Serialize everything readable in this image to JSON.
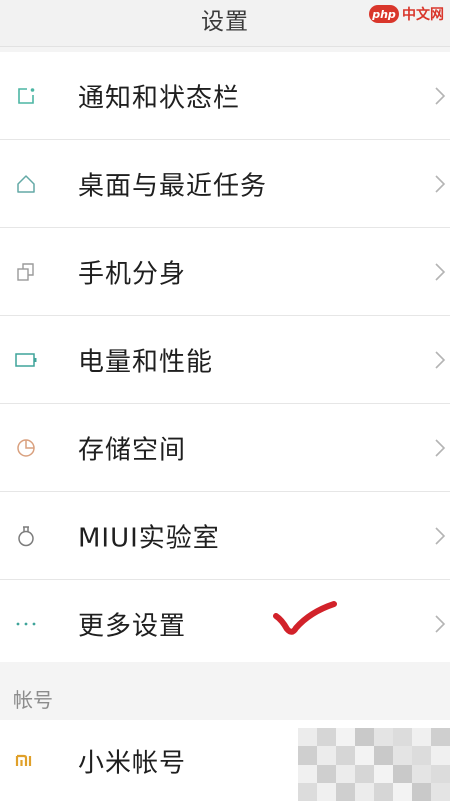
{
  "header": {
    "title": "设置"
  },
  "watermark": {
    "logo": "php",
    "text": "中文网"
  },
  "settings": {
    "items": [
      {
        "label": "通知和状态栏",
        "icon": "notification-icon",
        "color": "#4cb6a4"
      },
      {
        "label": "桌面与最近任务",
        "icon": "home-icon",
        "color": "#63a9a6"
      },
      {
        "label": "手机分身",
        "icon": "clone-icon",
        "color": "#9a9a9a"
      },
      {
        "label": "电量和性能",
        "icon": "battery-icon",
        "color": "#3fa49a"
      },
      {
        "label": "存储空间",
        "icon": "pie-chart-icon",
        "color": "#d9a07e"
      },
      {
        "label": "MIUI实验室",
        "icon": "flask-icon",
        "color": "#7c7c7c"
      },
      {
        "label": "更多设置",
        "icon": "more-dots-icon",
        "color": "#3fa49a"
      }
    ]
  },
  "account_section": {
    "header": "帐号",
    "items": [
      {
        "label": "小米帐号",
        "icon": "mi-logo-icon",
        "color": "#e0a02a"
      }
    ]
  },
  "colors": {
    "chevron": "#b4b4b4",
    "checkmark": "#d2222a"
  }
}
